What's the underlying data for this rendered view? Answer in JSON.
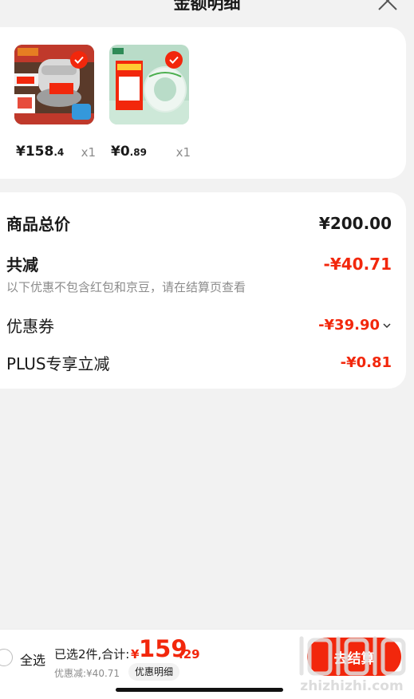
{
  "header": {
    "title": "金额明细"
  },
  "products": [
    {
      "price_main": "¥158",
      "price_small": ".4",
      "qty": "x1"
    },
    {
      "price_main": "¥0",
      "price_small": ".89",
      "qty": "x1"
    }
  ],
  "summary": {
    "total_label": "商品总价",
    "total_value": "¥200.00",
    "reduce_label": "共减",
    "reduce_value": "-¥40.71",
    "note": "以下优惠不包含红包和京豆，请在结算页查看",
    "coupon_label": "优惠券",
    "coupon_value": "-¥39.90",
    "plus_label": "PLUS专享立减",
    "plus_value": "-¥0.81"
  },
  "bottom_bar": {
    "select_all": "全选",
    "selected_text": "已选2件,合计:",
    "currency": "¥",
    "total_int": "159",
    "total_dec": ".29",
    "discount_text": "优惠减:¥40.71",
    "detail_chip": "优惠明细",
    "checkout_label": "去结算"
  },
  "watermark": {
    "text": "zhizhizhi.com"
  },
  "colors": {
    "accent": "#f2270c",
    "muted": "#8c8c8c"
  }
}
